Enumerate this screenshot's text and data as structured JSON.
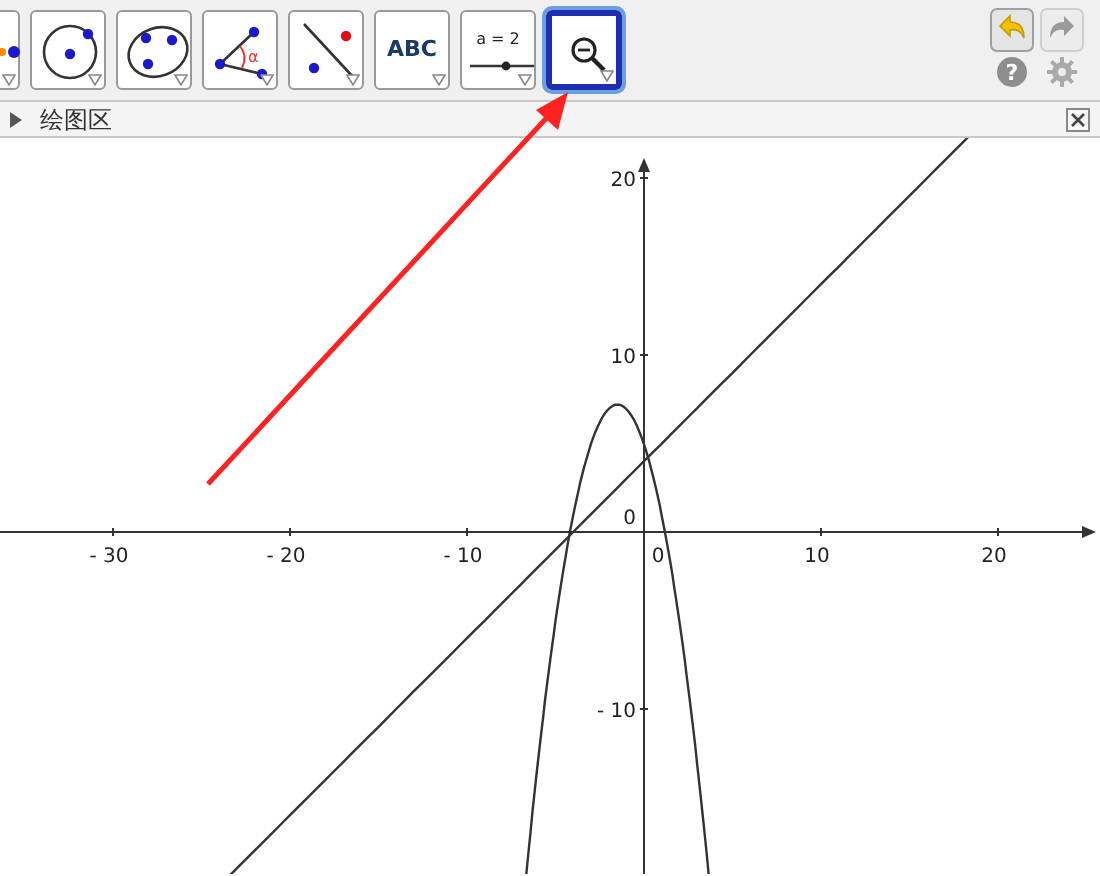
{
  "toolbar": {
    "tools": [
      {
        "kind": "point",
        "selected": false
      },
      {
        "kind": "circle",
        "selected": false
      },
      {
        "kind": "conic",
        "selected": false
      },
      {
        "kind": "angle",
        "symbol": "α",
        "selected": false
      },
      {
        "kind": "reflect",
        "selected": false
      },
      {
        "kind": "text",
        "label": "ABC",
        "selected": false
      },
      {
        "kind": "slider",
        "label": "a = 2",
        "selected": false
      },
      {
        "kind": "zoom",
        "selected": true
      }
    ]
  },
  "help": {
    "label": "?"
  },
  "view": {
    "title": "绘图区",
    "expanded": false
  },
  "graph": {
    "x_labels": [
      "- 30",
      "- 20",
      "- 10",
      "0",
      "10",
      "20"
    ],
    "y_labels": [
      "20",
      "10",
      "0",
      "- 10"
    ]
  }
}
